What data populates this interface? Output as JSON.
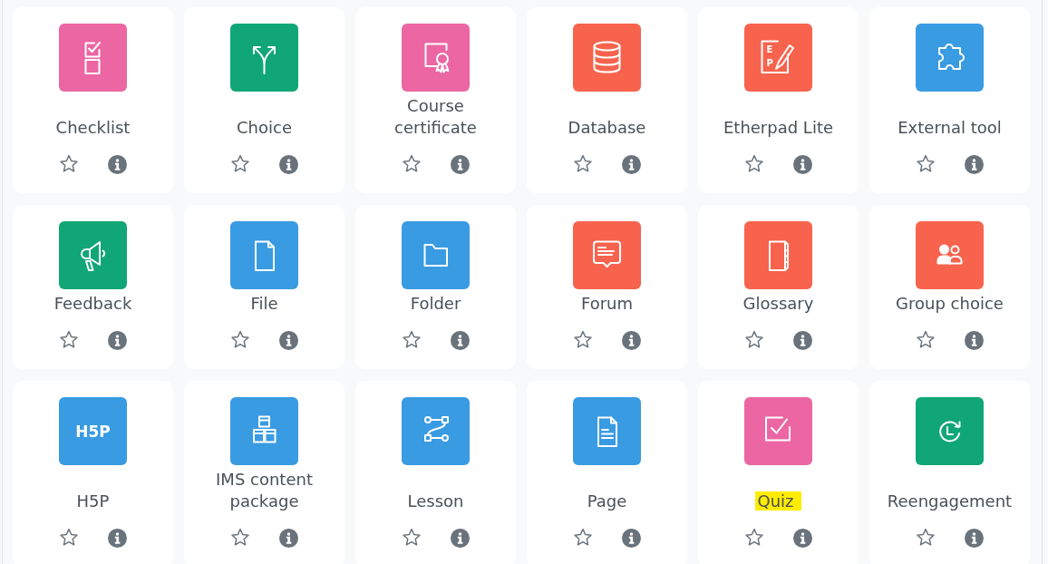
{
  "activities": [
    {
      "name": "Checklist",
      "kind": "checklist",
      "color": "#eb66a2",
      "starred": false,
      "highlighted": false
    },
    {
      "name": "Choice",
      "kind": "choice",
      "color": "#11a676",
      "starred": false,
      "highlighted": false
    },
    {
      "name": "Course certificate",
      "kind": "certificate",
      "color": "#eb66a2",
      "starred": false,
      "highlighted": false
    },
    {
      "name": "Database",
      "kind": "data",
      "color": "#f7634d",
      "starred": false,
      "highlighted": false
    },
    {
      "name": "Etherpad Lite",
      "kind": "etherpad",
      "color": "#f7634d",
      "starred": false,
      "highlighted": false,
      "icon_text": [
        "E",
        "P"
      ]
    },
    {
      "name": "External tool",
      "kind": "lti",
      "color": "#399be2",
      "starred": false,
      "highlighted": false
    },
    {
      "name": "Feedback",
      "kind": "feedback",
      "color": "#11a676",
      "starred": false,
      "highlighted": false
    },
    {
      "name": "File",
      "kind": "resource",
      "color": "#399be2",
      "starred": false,
      "highlighted": false
    },
    {
      "name": "Folder",
      "kind": "folder",
      "color": "#399be2",
      "starred": false,
      "highlighted": false
    },
    {
      "name": "Forum",
      "kind": "forum",
      "color": "#f7634d",
      "starred": false,
      "highlighted": false
    },
    {
      "name": "Glossary",
      "kind": "glossary",
      "color": "#f7634d",
      "starred": false,
      "highlighted": false
    },
    {
      "name": "Group choice",
      "kind": "choicegroup",
      "color": "#f7634d",
      "starred": false,
      "highlighted": false
    },
    {
      "name": "H5P",
      "kind": "h5p",
      "color": "#399be2",
      "starred": false,
      "highlighted": false,
      "icon_text": [
        "H5P"
      ]
    },
    {
      "name": "IMS content package",
      "kind": "imscp",
      "color": "#399be2",
      "starred": false,
      "highlighted": false
    },
    {
      "name": "Lesson",
      "kind": "lesson",
      "color": "#399be2",
      "starred": false,
      "highlighted": false
    },
    {
      "name": "Page",
      "kind": "page",
      "color": "#399be2",
      "starred": false,
      "highlighted": false
    },
    {
      "name": "Quiz",
      "kind": "quiz",
      "color": "#eb66a2",
      "starred": false,
      "highlighted": true
    },
    {
      "name": "Reengagement",
      "kind": "reengagement",
      "color": "#11a676",
      "starred": false,
      "highlighted": false
    }
  ]
}
